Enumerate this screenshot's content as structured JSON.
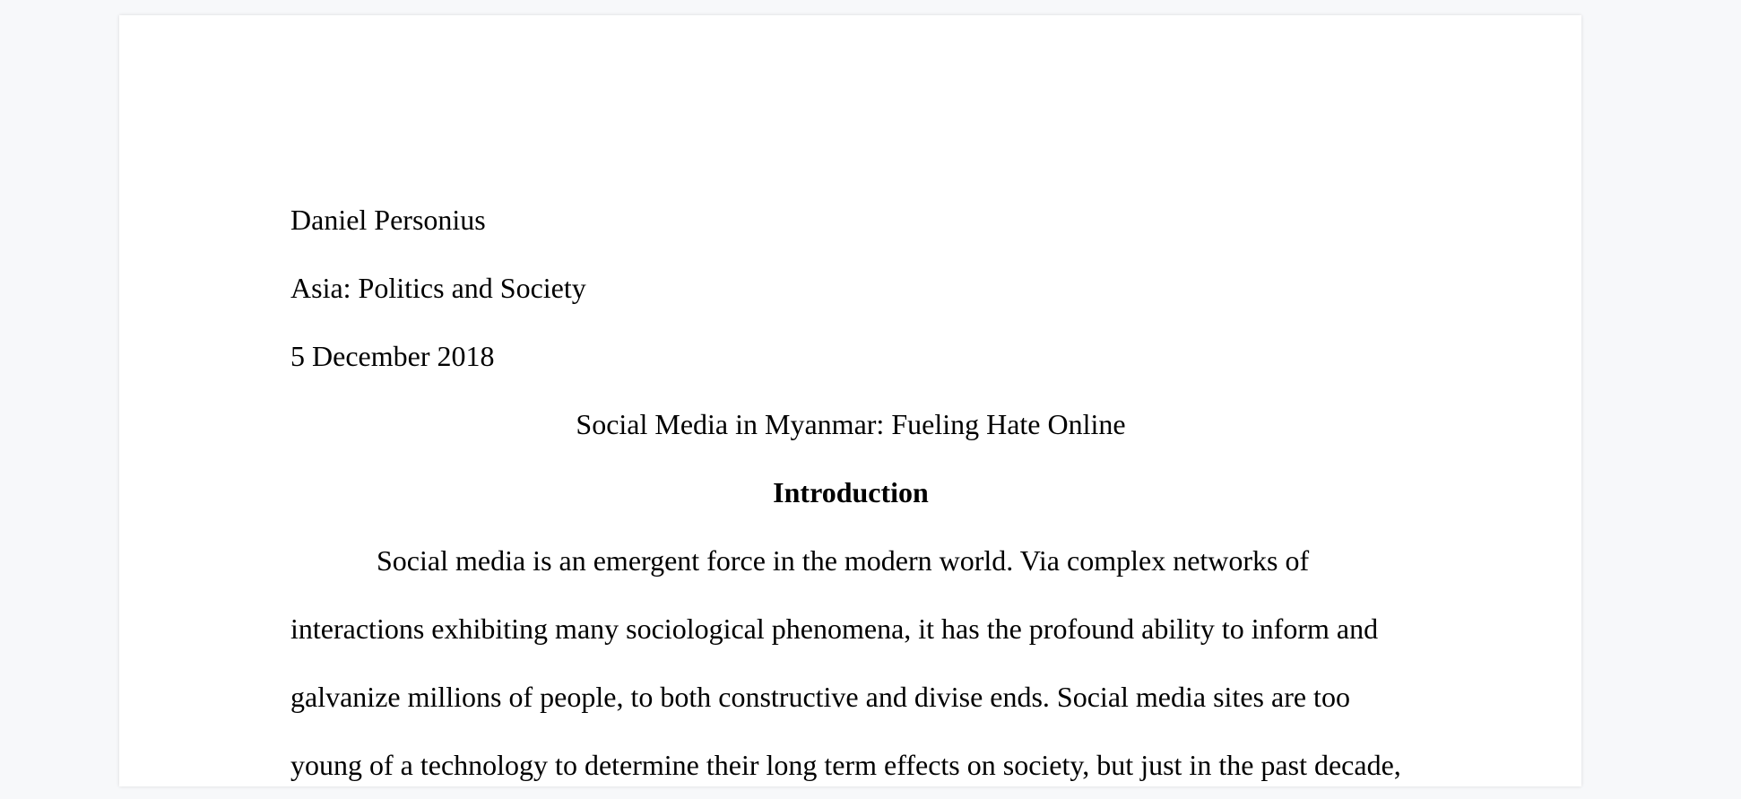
{
  "document": {
    "header": {
      "author": "Daniel Personius",
      "course": "Asia: Politics and Society",
      "date": "5 December 2018"
    },
    "title": "Social Media in Myanmar: Fueling Hate Online",
    "section_heading": "Introduction",
    "paragraph_lines": [
      "Social media is an emergent force in the modern world. Via complex networks of",
      "interactions exhibiting many sociological phenomena, it has the profound ability to inform and",
      "galvanize millions of people, to both constructive and divise ends. Social media sites are too",
      "young of a technology to determine their long term effects on society, but just in the past decade,"
    ]
  }
}
